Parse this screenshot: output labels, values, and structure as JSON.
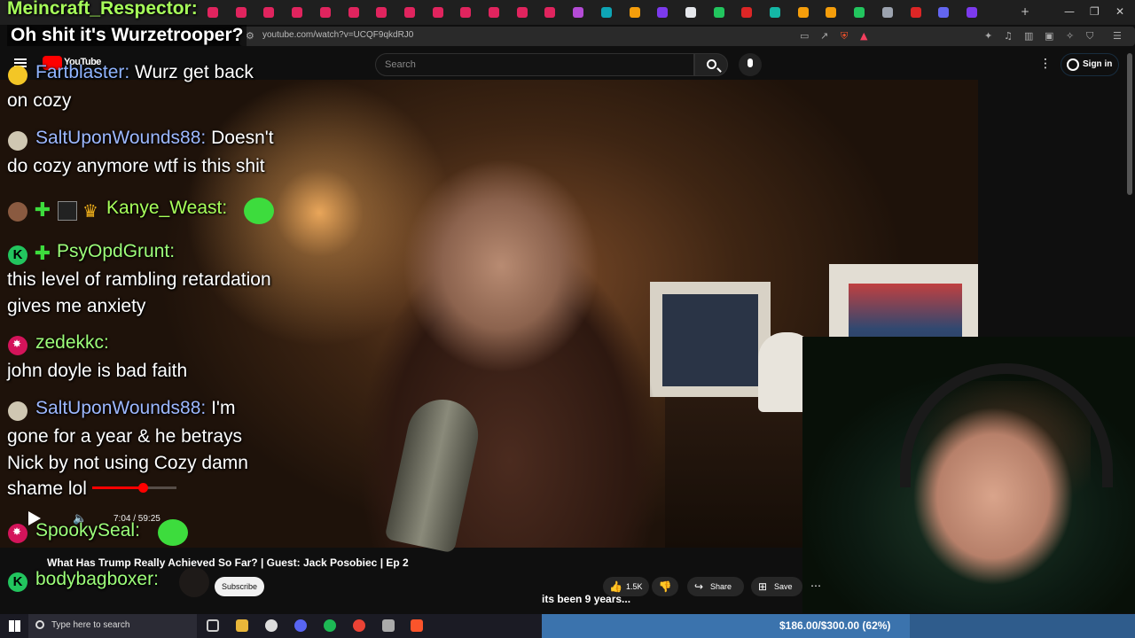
{
  "browser": {
    "url": "youtube.com/watch?v=UCQF9qkdRJ0",
    "tab_colors": [
      "#e0245e",
      "#e0245e",
      "#e0245e",
      "#e0245e",
      "#e0245e",
      "#e0245e",
      "#e0245e",
      "#e0245e",
      "#e0245e",
      "#e0245e",
      "#e0245e",
      "#e0245e",
      "#e0245e",
      "#b44bd6",
      "#0ea5b5",
      "#f59e0b",
      "#7c3aed",
      "#e5e7eb",
      "#22c55e",
      "#dc2626",
      "#14b8a6",
      "#f59e0b",
      "#f59e0b",
      "#22c55e",
      "#9ca3af",
      "#dc2626",
      "#6366f1",
      "#7c3aed"
    ]
  },
  "youtube": {
    "logo_text": "YouTube",
    "search_placeholder": "Search",
    "signin_label": "Sign in",
    "video_title": "What Has Trump Really Achieved So Far? | Guest: Jack Posobiec | Ep 2",
    "subscribe_label": "Subscribe",
    "like_count": "1.5K",
    "share_label": "Share",
    "save_label": "Save",
    "time_display": "7:04 / 59:25",
    "progress": 0.6,
    "caption": "its been 9 years..."
  },
  "chat": {
    "header_user": "Meincraft_Respector:",
    "header_message": "Oh shit it's Wurzetrooper?",
    "messages": [
      {
        "user": "Fartblaster:",
        "text1": "Wurz get back",
        "text2": "on cozy",
        "user_color": "#8fb4ff"
      },
      {
        "user": "SaltUponWounds88:",
        "text1": "Doesn't",
        "text2": "do cozy anymore wtf is this shit",
        "user_color": "#9db8ff"
      },
      {
        "user": "Kanye_Weast:",
        "user_color": "#a7ff5a"
      },
      {
        "user": "PsyOpdGrunt:",
        "text1": "this level of rambling retardation",
        "text2": "gives me anxiety",
        "user_color": "#9dff7a"
      },
      {
        "user": "zedekkc:",
        "text1": "john doyle is bad faith",
        "user_color": "#9dff7a"
      },
      {
        "user": "SaltUponWounds88:",
        "text1": "I'm",
        "text2": "gone for a year & he betrays",
        "text3": "Nick by not using Cozy damn",
        "text4": "shame lol",
        "user_color": "#9db8ff"
      },
      {
        "user": "SpookySeal:",
        "user_color": "#9dff7a"
      },
      {
        "user": "bodybagboxer:",
        "user_color": "#9dff7a"
      }
    ]
  },
  "taskbar": {
    "search_placeholder": "Type here to search",
    "donation_text": "$186.00/$300.00 (62%)",
    "donation_progress": 0.62
  },
  "colors": {
    "youtube_red": "#ff0000",
    "kick_green": "#22c55e",
    "donation_blue": "#2f5c8c"
  }
}
